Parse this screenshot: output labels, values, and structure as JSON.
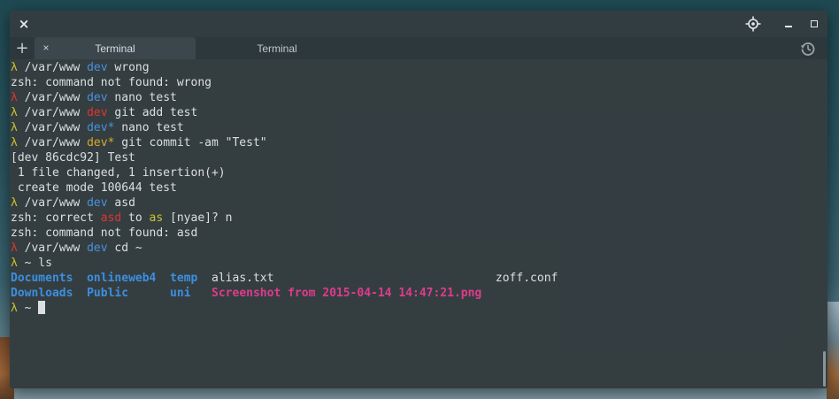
{
  "colors": {
    "lambda_ok": "#c9c32e",
    "lambda_err": "#e0352f",
    "branch_clean": "#4a90dc",
    "branch_dirty": "#d9a82b",
    "branch_red": "#e0352f",
    "directory": "#3c8fe0",
    "image_file": "#e03a8c"
  },
  "window": {
    "icons": {
      "close": "close-icon",
      "target": "crosshair-icon",
      "minimize": "minimize-icon",
      "maximize": "maximize-icon"
    },
    "close_glyph": "×",
    "add_tab_glyph": "+",
    "tab_close_glyph": "×"
  },
  "tabs": [
    {
      "label": "Terminal",
      "active": true
    },
    {
      "label": "Terminal",
      "active": false
    }
  ],
  "terminal": {
    "lines": [
      [
        {
          "t": "λ ",
          "c": "yellow"
        },
        {
          "t": "/var/www "
        },
        {
          "t": "dev",
          "c": "blue"
        },
        {
          "t": " wrong"
        }
      ],
      [
        {
          "t": "zsh: command not found: wrong"
        }
      ],
      [
        {
          "t": "λ ",
          "c": "red"
        },
        {
          "t": "/var/www "
        },
        {
          "t": "dev",
          "c": "blue"
        },
        {
          "t": " nano test"
        }
      ],
      [
        {
          "t": "λ ",
          "c": "yellow"
        },
        {
          "t": "/var/www "
        },
        {
          "t": "dev",
          "c": "red"
        },
        {
          "t": " git add test"
        }
      ],
      [
        {
          "t": "λ ",
          "c": "yellow"
        },
        {
          "t": "/var/www "
        },
        {
          "t": "dev*",
          "c": "blue"
        },
        {
          "t": " nano test"
        }
      ],
      [
        {
          "t": "λ ",
          "c": "yellow"
        },
        {
          "t": "/var/www "
        },
        {
          "t": "dev*",
          "c": "gold"
        },
        {
          "t": " git commit -am \"Test\""
        }
      ],
      [
        {
          "t": "[dev 86cdc92] Test"
        }
      ],
      [
        {
          "t": " 1 file changed, 1 insertion(+)"
        }
      ],
      [
        {
          "t": " create mode 100644 test"
        }
      ],
      [
        {
          "t": "λ ",
          "c": "yellow"
        },
        {
          "t": "/var/www "
        },
        {
          "t": "dev",
          "c": "blue"
        },
        {
          "t": " asd"
        }
      ],
      [
        {
          "t": "zsh: correct "
        },
        {
          "t": "asd",
          "c": "red"
        },
        {
          "t": " to "
        },
        {
          "t": "as",
          "c": "yellow"
        },
        {
          "t": " [nyae]? n"
        }
      ],
      [
        {
          "t": "zsh: command not found: asd"
        }
      ],
      [
        {
          "t": "λ ",
          "c": "red"
        },
        {
          "t": "/var/www "
        },
        {
          "t": "dev",
          "c": "blue"
        },
        {
          "t": " cd ~"
        }
      ],
      [
        {
          "t": "λ ",
          "c": "yellow"
        },
        {
          "t": "~ ls"
        }
      ],
      [
        {
          "t": "Documents",
          "c": "dir"
        },
        {
          "t": "  "
        },
        {
          "t": "onlineweb4",
          "c": "dir"
        },
        {
          "t": "  "
        },
        {
          "t": "temp",
          "c": "dir"
        },
        {
          "t": "  alias.txt                                zoff.conf"
        }
      ],
      [
        {
          "t": "Downloads",
          "c": "dir"
        },
        {
          "t": "  "
        },
        {
          "t": "Public",
          "c": "dir"
        },
        {
          "t": "      "
        },
        {
          "t": "uni",
          "c": "dir"
        },
        {
          "t": "   "
        },
        {
          "t": "Screenshot from 2015-04-14 14:47:21.png",
          "c": "img"
        }
      ],
      [
        {
          "t": "λ ",
          "c": "yellow"
        },
        {
          "t": "~ "
        },
        {
          "cursor": true
        }
      ]
    ]
  }
}
